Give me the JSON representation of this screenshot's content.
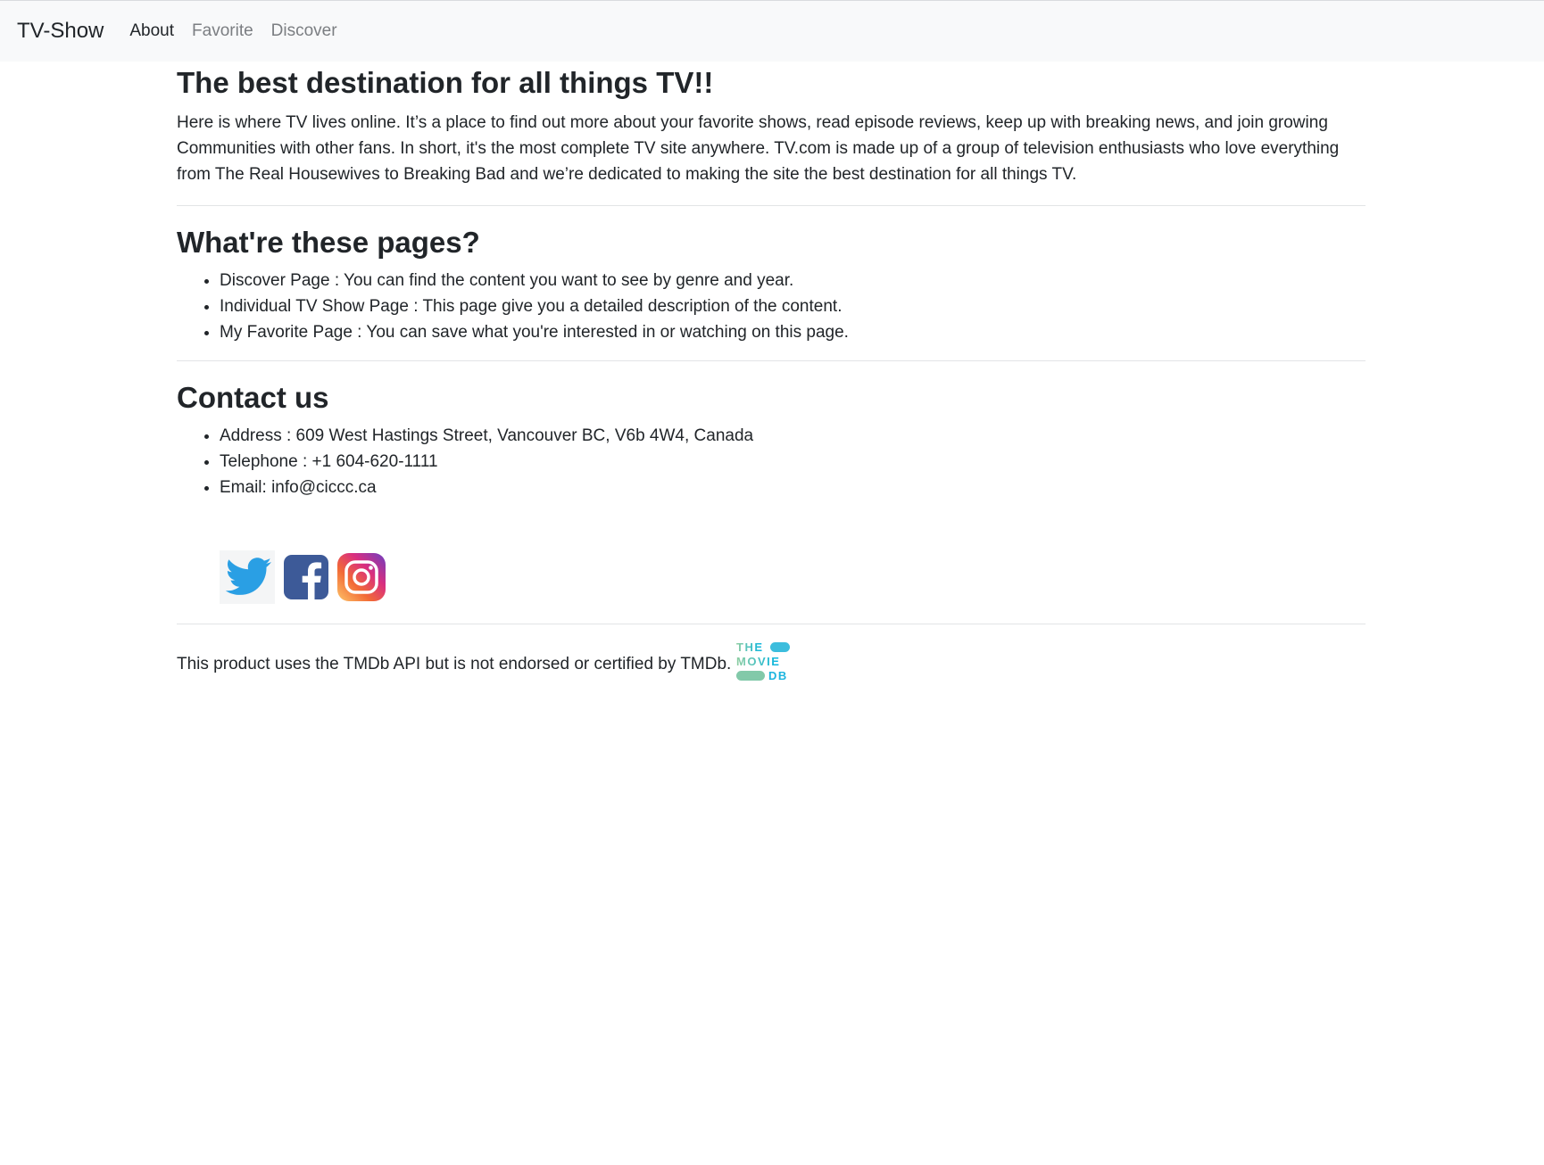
{
  "navbar": {
    "brand": "TV-Show",
    "links": [
      {
        "label": "About",
        "active": true
      },
      {
        "label": "Favorite",
        "active": false
      },
      {
        "label": "Discover",
        "active": false
      }
    ]
  },
  "intro": {
    "title": "The best destination for all things TV!!",
    "text": "Here is where TV lives online. It’s a place to find out more about your favorite shows, read episode reviews, keep up with breaking news, and join growing Communities with other fans. In short, it's the most complete TV site anywhere. TV.com is made up of a group of television enthusiasts who love everything from The Real Housewives to Breaking Bad and we’re dedicated to making the site the best destination for all things TV."
  },
  "pages": {
    "title": "What're these pages?",
    "items": [
      "Discover Page : You can find the content you want to see by genre and year.",
      "Individual TV Show Page : This page give you a detailed description of the content.",
      "My Favorite Page : You can save what you're interested in or watching on this page."
    ]
  },
  "contact": {
    "title": "Contact us",
    "items": [
      "Address : 609 West Hastings Street, Vancouver BC, V6b 4W4, Canada",
      "Telephone : +1 604-620-1111",
      "Email: info@ciccc.ca"
    ]
  },
  "social": {
    "icons": [
      "twitter-icon",
      "facebook-icon",
      "instagram-icon"
    ],
    "colors": {
      "twitter": "#1da1f2",
      "facebook": "#3b5998"
    }
  },
  "footer": {
    "text": "This product uses the TMDb API but is not endorsed or certified by TMDb.",
    "logo": {
      "line1": "THE",
      "line2": "MOVIE",
      "line3": "DB"
    }
  }
}
